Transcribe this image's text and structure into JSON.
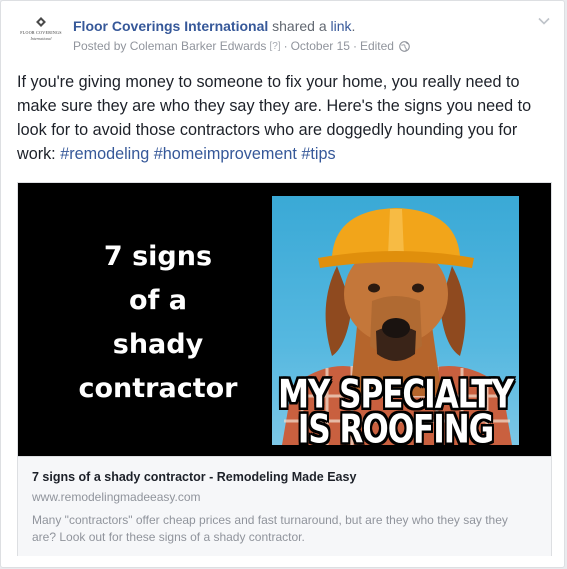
{
  "post": {
    "page_name": "Floor Coverings International",
    "shared_text": " shared a ",
    "link_word": "link",
    "period": ".",
    "posted_by": "Posted by Coleman Barker Edwards",
    "help_marker": "[?]",
    "separator": "·",
    "date": "October 15",
    "edited": "Edited",
    "body_text": "If you're giving money to someone to fix your home, you really need to make sure they are who they say they are. Here's the signs you need to look for to avoid those contractors who are doggedly hounding you for work: ",
    "hashtags": [
      "#remodeling",
      "#homeimprovement",
      "#tips"
    ]
  },
  "logo": {
    "line1": "FLOOR COVERINGS",
    "line2": "International"
  },
  "share": {
    "image_text_lines": [
      "7 signs",
      "of a",
      "shady",
      "contractor"
    ],
    "meme_caption_1": "MY SPECIALTY",
    "meme_caption_2": "IS ROOFING",
    "title": "7 signs of a shady contractor - Remodeling Made Easy",
    "domain": "www.remodelingmadeeasy.com",
    "description": "Many \"contractors\" offer cheap prices and fast turnaround, but are they who they say they are? Look out for these signs of a shady contractor."
  },
  "icons": {
    "logo": "diamond-logo-icon",
    "privacy": "globe-icon",
    "menu": "chevron-down-icon"
  },
  "colors": {
    "link": "#365899",
    "text": "#1d2129",
    "meta": "#90949c",
    "share_bg": "#f6f7f9",
    "hard_hat": "#f2a51a",
    "sky": "#4fb3dd"
  }
}
